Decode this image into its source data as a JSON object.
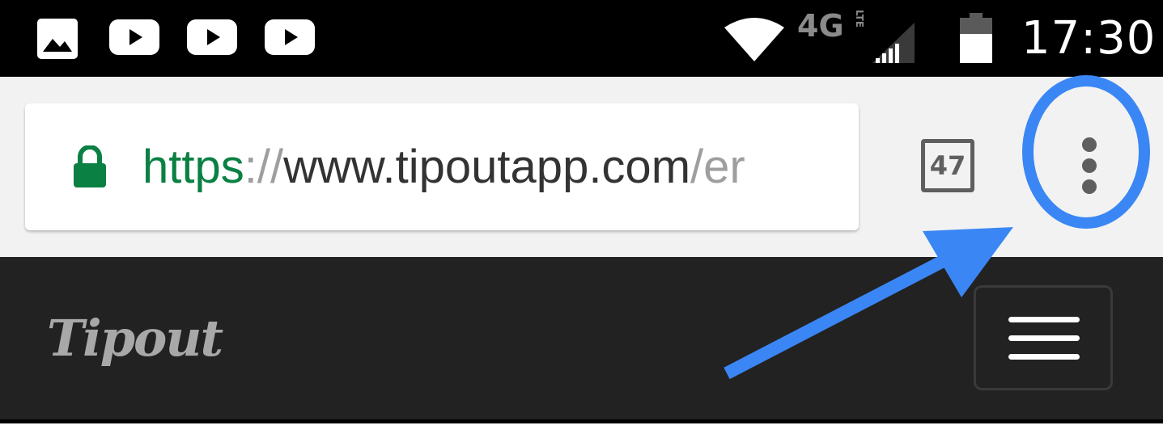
{
  "status_bar": {
    "time": "17:30",
    "network": "4G",
    "network_sub": "LTE",
    "notifications": [
      "image-icon",
      "youtube-icon",
      "youtube-icon",
      "youtube-icon"
    ]
  },
  "browser": {
    "url": {
      "scheme": "https",
      "separator": "://",
      "host": "www.tipoutapp.com",
      "path": "/er"
    },
    "tab_count": "47",
    "colors": {
      "secure": "#0b8043",
      "icon_gray": "#5f5f5f",
      "annotation": "#3b86f5"
    }
  },
  "site": {
    "logo": "Tipout",
    "menu_icon": "hamburger-icon"
  }
}
